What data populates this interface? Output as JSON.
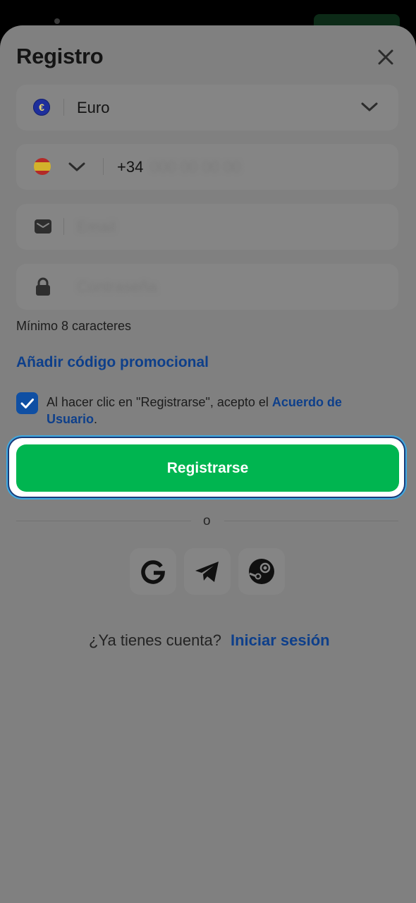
{
  "status": {
    "dot": "status-dot"
  },
  "dialog": {
    "title": "Registro",
    "close_icon": "close-icon"
  },
  "currency": {
    "symbol": "€",
    "label": "Euro",
    "icon": "euro-icon"
  },
  "phone": {
    "country_flag": "spain-flag-icon",
    "prefix": "+34",
    "placeholder": "000 00 00 00"
  },
  "email": {
    "icon": "envelope-icon",
    "placeholder": "Email"
  },
  "password": {
    "icon": "lock-icon",
    "placeholder": "Contraseña",
    "hint": "Mínimo 8 caracteres"
  },
  "promo": {
    "label": "Añadir código promocional"
  },
  "terms": {
    "checked": true,
    "text": "Al hacer clic en \"Registrarse\", acepto el ",
    "link": "Acuerdo de Usuario",
    "end": "."
  },
  "register_button": {
    "label": "Registrarse"
  },
  "divider": {
    "label": "o"
  },
  "social": [
    {
      "name": "google-icon"
    },
    {
      "name": "telegram-icon"
    },
    {
      "name": "steam-icon"
    }
  ],
  "login": {
    "question": "¿Ya tienes cuenta?",
    "link": "Iniciar sesión"
  },
  "colors": {
    "accent": "#00b550",
    "link": "#0e3f8a",
    "overlay": "#808080",
    "field": "#858585"
  }
}
